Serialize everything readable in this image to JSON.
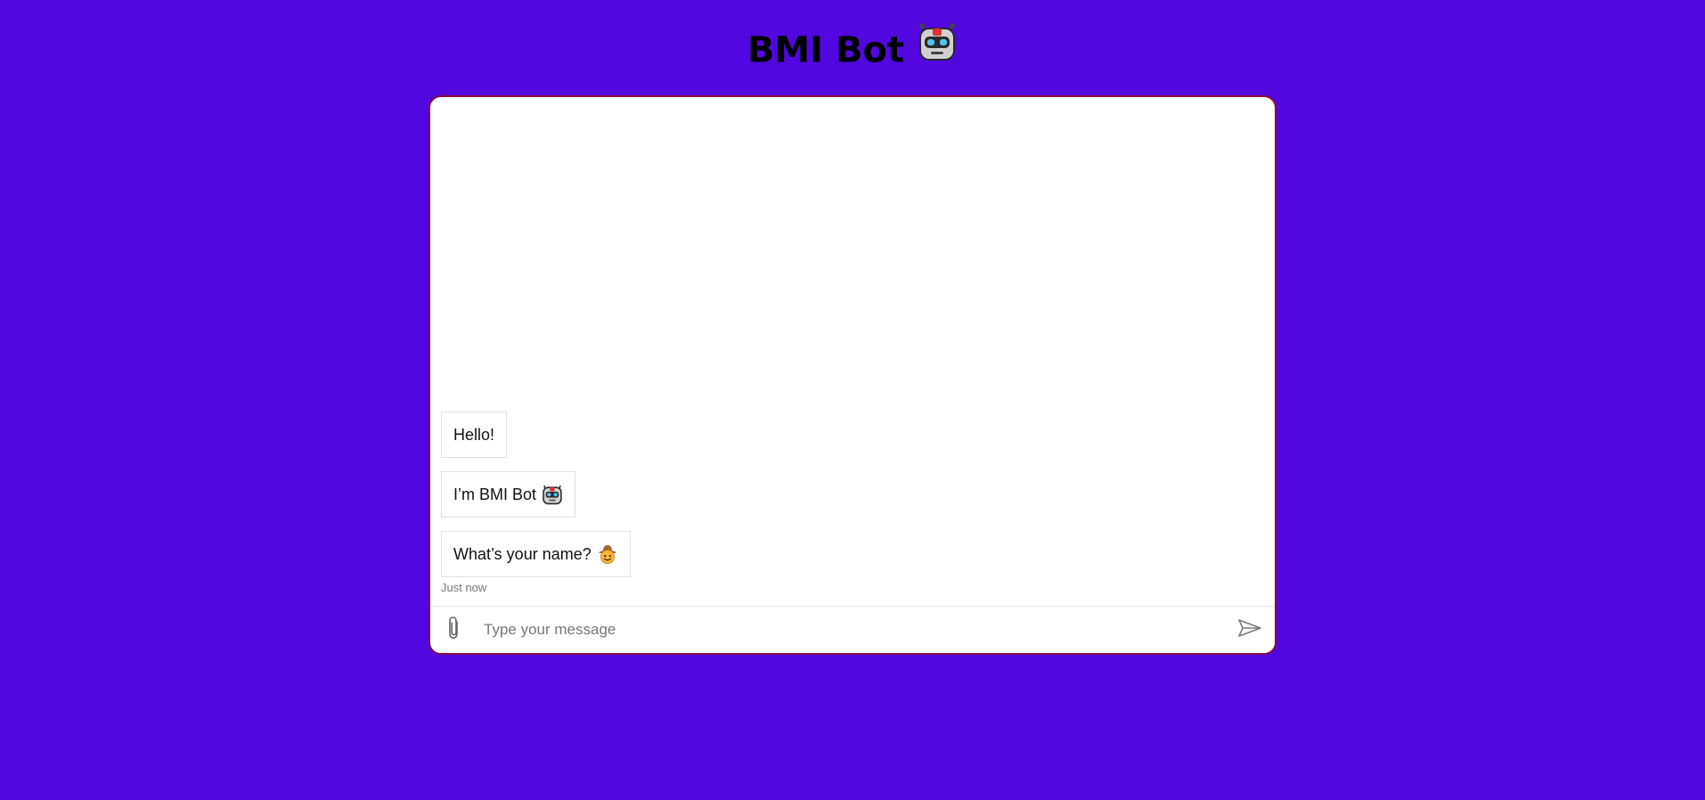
{
  "page": {
    "title": "BMI Bot",
    "title_icon": "robot-face-icon",
    "background_color": "#5206e0",
    "border_color": "#8a0a3e"
  },
  "chat": {
    "messages": [
      {
        "text": "Hello!",
        "icon": null
      },
      {
        "text": "I’m BMI Bot",
        "icon": "robot-face-icon"
      },
      {
        "text": "What’s your name?",
        "icon": "cowboy-face-icon"
      }
    ],
    "timestamp": "Just now"
  },
  "composer": {
    "placeholder": "Type your message",
    "value": "",
    "attach_icon": "paperclip-icon",
    "send_icon": "send-icon"
  }
}
